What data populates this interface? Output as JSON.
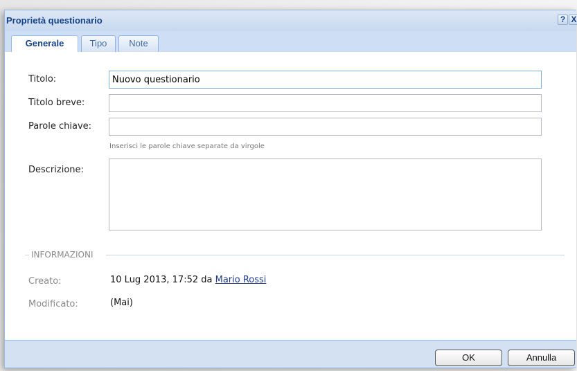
{
  "window": {
    "title": "Proprietà questionario",
    "help_glyph": "?",
    "close_glyph": "X"
  },
  "tabs": [
    {
      "label": "Generale",
      "active": true
    },
    {
      "label": "Tipo",
      "active": false
    },
    {
      "label": "Note",
      "active": false
    }
  ],
  "form": {
    "title_label": "Titolo:",
    "title_value": "Nuovo questionario",
    "short_title_label": "Titolo breve:",
    "short_title_value": "",
    "keywords_label": "Parole chiave:",
    "keywords_value": "",
    "keywords_hint": "Inserisci le parole chiave separate da virgole",
    "description_label": "Descrizione:",
    "description_value": ""
  },
  "info": {
    "legend": "INFORMAZIONI",
    "created_label": "Creato:",
    "created_value": "10 Lug 2013, 17:52 da",
    "created_by": "Mario Rossi",
    "modified_label": "Modificato:",
    "modified_value": "(Mai)"
  },
  "buttons": {
    "ok": "OK",
    "cancel": "Annulla"
  },
  "colors": {
    "title_text": "#15428b",
    "frame": "#d4e1f2",
    "border": "#99bbe8"
  }
}
